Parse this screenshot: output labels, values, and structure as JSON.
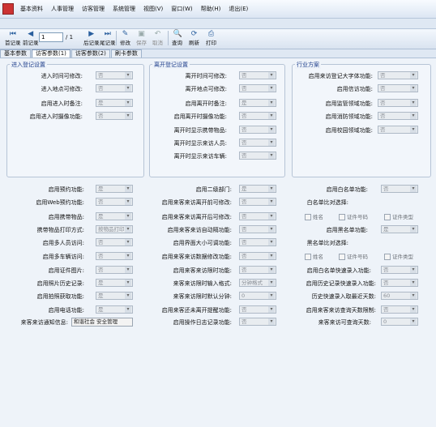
{
  "menu": [
    "基本资料",
    "人事管理",
    "访客管理",
    "系统管理",
    "视图(V)",
    "窗口(W)",
    "帮助(H)",
    "退出(E)"
  ],
  "toolbar": {
    "first": "首记录",
    "prev": "前记录",
    "record_value": "1",
    "record_total": "/ 1",
    "next": "后记录",
    "last": "尾记录",
    "modify": "修改",
    "save": "保存",
    "cancel": "取消",
    "query": "查询",
    "refresh": "刷新",
    "print": "打印"
  },
  "tabs": [
    "基本参数",
    "访客参数(1)",
    "访客参数(2)",
    "刷卡参数"
  ],
  "groups": {
    "entry": {
      "title": "进入登记设置",
      "items": [
        {
          "label": "进入时间可修改:",
          "value": "否"
        },
        {
          "label": "进入地点可修改:",
          "value": "否"
        },
        {
          "label": "启用进入时备注:",
          "value": "是"
        },
        {
          "label": "启用进入时摄像功能:",
          "value": "否"
        }
      ]
    },
    "leave": {
      "title": "离开登记设置",
      "items": [
        {
          "label": "离开时间可修改:",
          "value": "否"
        },
        {
          "label": "离开地点可修改:",
          "value": "否"
        },
        {
          "label": "启用离开时备注:",
          "value": "是"
        },
        {
          "label": "启用离开时摄像功能:",
          "value": "否"
        },
        {
          "label": "离开时显示携带物品:",
          "value": "否"
        },
        {
          "label": "离开时显示来访人员:",
          "value": "否"
        },
        {
          "label": "离开时显示来访车辆:",
          "value": "否"
        }
      ]
    },
    "industry": {
      "title": "行业方案",
      "items": [
        {
          "label": "启用来访登记大字体功能:",
          "value": "否"
        },
        {
          "label": "启用信访功能:",
          "value": "否"
        },
        {
          "label": "启用监管领域功能:",
          "value": "否"
        },
        {
          "label": "启用消防领域功能:",
          "value": "否"
        },
        {
          "label": "启用校园领域功能:",
          "value": "否"
        }
      ]
    }
  },
  "col1": [
    {
      "label": "启用预约功能:",
      "value": "是"
    },
    {
      "label": "启用Web预约功能:",
      "value": "否"
    },
    {
      "label": "启用携带物品:",
      "value": "是"
    },
    {
      "label": "携带物品打印方式:",
      "value": "按物品打印"
    },
    {
      "label": "启用多人员访问:",
      "value": "否"
    },
    {
      "label": "启用多车辆访问:",
      "value": "否"
    },
    {
      "label": "启用证件图片:",
      "value": "否"
    },
    {
      "label": "启用照片历史记录:",
      "value": "是"
    },
    {
      "label": "启用拍照获取功能:",
      "value": "是"
    },
    {
      "label": "启用电话功能:",
      "value": "是"
    }
  ],
  "notify": {
    "label": "来客来访通知信息:",
    "value": "和谐社会 安全管理"
  },
  "col2": [
    {
      "label": "启用二级部门:",
      "value": "是"
    },
    {
      "label": "启用来客来访离开前可修改:",
      "value": "否"
    },
    {
      "label": "启用来客来访离开后可修改:",
      "value": "否"
    },
    {
      "label": "启用来客来访自动隔功能:",
      "value": "否"
    },
    {
      "label": "启用界面大小可调功能:",
      "value": "否"
    },
    {
      "label": "启用来客来访数据修改功能:",
      "value": "否"
    },
    {
      "label": "启用来客来访限时功能:",
      "value": "否"
    },
    {
      "label": "来客来访限时输入格式:",
      "value": "分钟格式"
    },
    {
      "label": "来客来访限时默认分钟:",
      "value": "0"
    },
    {
      "label": "启用来客还未离开提醒功能:",
      "value": "否"
    },
    {
      "label": "启用操作日志记录功能:",
      "value": "否"
    }
  ],
  "col3": {
    "whitelist_label": "启用白名单功能:",
    "whitelist_value": "否",
    "whitelist_compare": "白名单比对选择:",
    "whitelist_checks": [
      "姓名",
      "证件号码",
      "证件类型"
    ],
    "blacklist_label": "启用黑名单功能:",
    "blacklist_value": "是",
    "blacklist_compare": "黑名单比对选择:",
    "blacklist_checks": [
      "姓名",
      "证件号码",
      "证件类型"
    ],
    "fast_label": "启用白名单快速录入功能:",
    "fast_value": "否",
    "history_label": "启用历史记录快速录入功能:",
    "history_value": "否",
    "days_label": "历史快速录入取最近天数:",
    "days_value": "60",
    "limit_label": "启用来客来访查询天数限制:",
    "limit_value": "否",
    "query_days_label": "来客来访可查询天数:",
    "query_days_value": "0"
  }
}
